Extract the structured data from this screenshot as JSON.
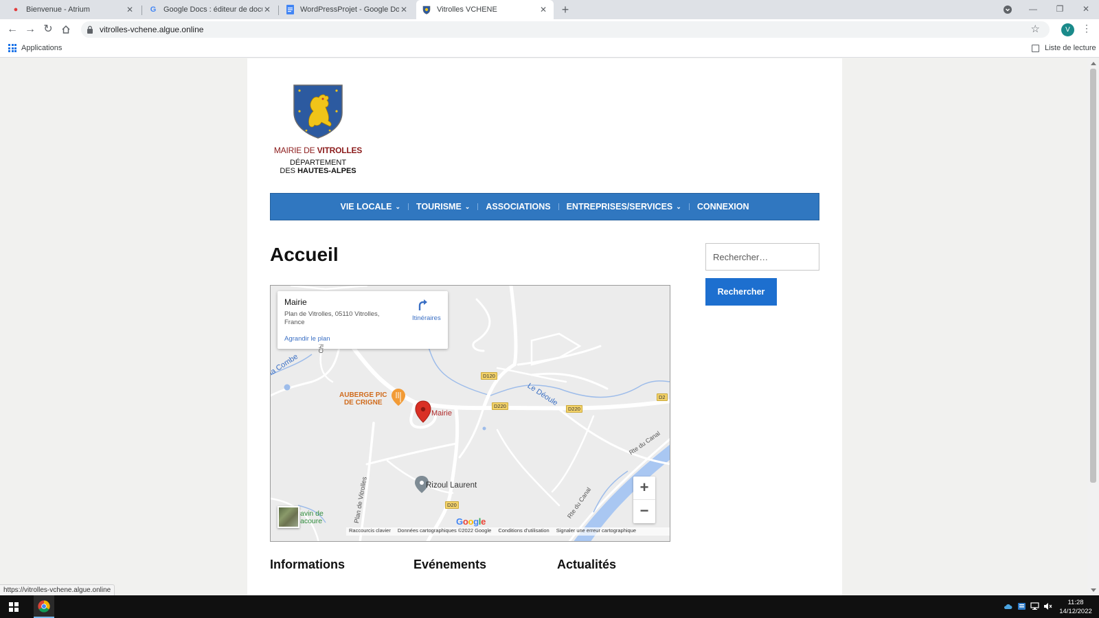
{
  "browser": {
    "tabs": [
      {
        "title": "Bienvenue - Atrium",
        "active": false
      },
      {
        "title": "Google Docs : éditeur de docume",
        "active": false
      },
      {
        "title": "WordPressProjet - Google Docs",
        "active": false
      },
      {
        "title": "Vitrolles VCHENE",
        "active": true
      }
    ],
    "url": "vitrolles-vchene.algue.online",
    "profile_initial": "V",
    "bookmarks": {
      "apps_label": "Applications",
      "reading_list_label": "Liste de lecture"
    },
    "status_url": "https://vitrolles-vchene.algue.online"
  },
  "site": {
    "logo": {
      "mairie_prefix": "MAIRIE DE ",
      "mairie_name": "VITROLLES",
      "dept_line1": "DÉPARTEMENT",
      "dept_prefix": "DES ",
      "dept_name": "HAUTES-ALPES"
    },
    "nav": [
      {
        "label": "VIE LOCALE",
        "dropdown": true
      },
      {
        "label": "TOURISME",
        "dropdown": true
      },
      {
        "label": "ASSOCIATIONS",
        "dropdown": false
      },
      {
        "label": "ENTREPRISES/SERVICES",
        "dropdown": true
      },
      {
        "label": "CONNEXION",
        "dropdown": false
      }
    ],
    "page_title": "Accueil",
    "search": {
      "placeholder": "Rechercher…",
      "button": "Rechercher"
    },
    "sections": [
      "Informations",
      "Evénements",
      "Actualités"
    ]
  },
  "map": {
    "card": {
      "title": "Mairie",
      "address": "Plan de Vitrolles, 05110 Vitrolles, France",
      "directions": "Itinéraires",
      "enlarge": "Agrandir le plan"
    },
    "labels": {
      "auberge": "AUBERGE PIC\nDE CRIGNE",
      "mairie": "Mairie",
      "rizoul": "Rizoul Laurent",
      "deoule": "Le Déoule",
      "combe": "la Combe",
      "ch": "Chi",
      "plan": "Plan de Vitrolles",
      "canal1": "Rte du Canal",
      "canal2": "Rte du Canal",
      "ravin": "avin de\nacoure"
    },
    "roads": [
      "D120",
      "D220",
      "D220",
      "D2",
      "D20"
    ],
    "footer": [
      "Raccourcis clavier",
      "Données cartographiques ©2022 Google",
      "Conditions d'utilisation",
      "Signaler une erreur cartographique"
    ],
    "zoom_in": "+",
    "zoom_out": "−",
    "google": "Google"
  },
  "taskbar": {
    "time": "11:28",
    "date": "14/12/2022"
  },
  "colors": {
    "nav_bg": "#3077c0",
    "button_bg": "#1d6fcf",
    "mairie_red": "#8b1a1a",
    "pin_red": "#d93025"
  }
}
